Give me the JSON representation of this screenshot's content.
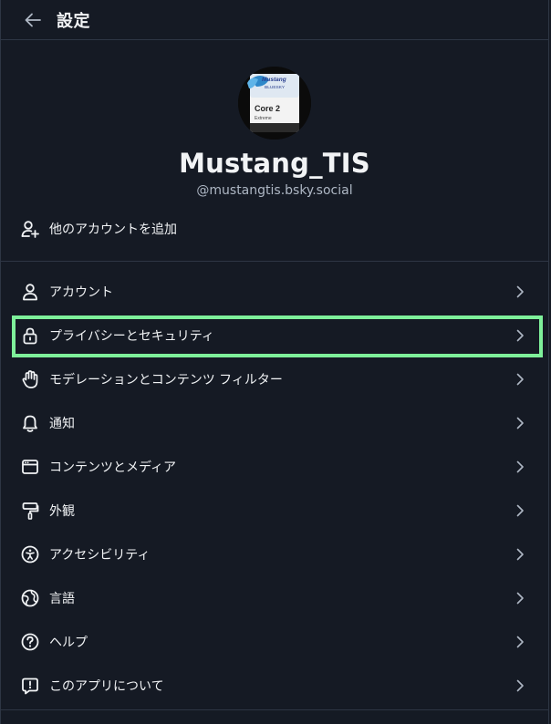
{
  "header": {
    "title": "設定",
    "back_icon": "arrow-left-icon"
  },
  "profile": {
    "display_name": "Mustang_TIS",
    "handle": "@mustangtis.bsky.social",
    "avatar_text": {
      "brand": "Mustang",
      "sub": "BLUESKY",
      "core": "Core 2",
      "edition": "Extreme"
    }
  },
  "add_account": {
    "label": "他のアカウントを追加",
    "icon": "person-plus-icon"
  },
  "menu": [
    {
      "label": "アカウント",
      "icon": "person-icon"
    },
    {
      "label": "プライバシーとセキュリティ",
      "icon": "lock-icon",
      "highlighted": true
    },
    {
      "label": "モデレーションとコンテンツ フィルター",
      "icon": "hand-icon"
    },
    {
      "label": "通知",
      "icon": "bell-icon"
    },
    {
      "label": "コンテンツとメディア",
      "icon": "window-icon"
    },
    {
      "label": "外観",
      "icon": "paint-roller-icon"
    },
    {
      "label": "アクセシビリティ",
      "icon": "accessibility-icon"
    },
    {
      "label": "言語",
      "icon": "globe-icon"
    },
    {
      "label": "ヘルプ",
      "icon": "question-circle-icon"
    },
    {
      "label": "このアプリについて",
      "icon": "info-message-icon"
    }
  ],
  "colors": {
    "background": "#151a24",
    "text": "#f1f3f5",
    "muted": "#aeb7c4",
    "divider": "#2e3644",
    "highlight": "#7ef09a"
  }
}
